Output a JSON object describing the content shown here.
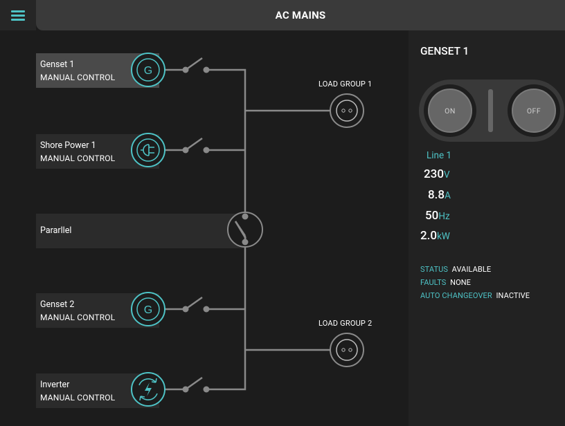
{
  "header": {
    "title": "AC MAINS"
  },
  "sources": [
    {
      "name": "Genset 1",
      "mode": "MANUAL CONTROL",
      "icon": "generator-icon"
    },
    {
      "name": "Shore Power 1",
      "mode": "MANUAL CONTROL",
      "icon": "shore-power-icon"
    },
    {
      "name": "Genset 2",
      "mode": "MANUAL CONTROL",
      "icon": "generator-icon"
    },
    {
      "name": "Inverter",
      "mode": "MANUAL CONTROL",
      "icon": "inverter-icon"
    }
  ],
  "parallel": {
    "label": "Pararllel"
  },
  "loads": [
    {
      "label": "LOAD GROUP 1"
    },
    {
      "label": "LOAD GROUP 2"
    }
  ],
  "panel": {
    "title": "GENSET 1",
    "on_label": "ON",
    "off_label": "OFF",
    "line_label": "Line 1",
    "voltage": {
      "value": "230",
      "unit": "V"
    },
    "current": {
      "value": "8.8",
      "unit": "A"
    },
    "frequency": {
      "value": "50",
      "unit": "Hz"
    },
    "power": {
      "value": "2.0",
      "unit": "kW"
    },
    "status": {
      "key": "STATUS",
      "value": "AVAILABLE"
    },
    "faults": {
      "key": "FAULTS",
      "value": "NONE"
    },
    "auto_changeover": {
      "key": "AUTO CHANGEOVER",
      "value": "INACTIVE"
    }
  },
  "colors": {
    "accent": "#4ec3c6",
    "line": "#8a8a8a",
    "header": "#3a3a3a",
    "background": "#1c1c1c"
  },
  "generator_glyph": "G"
}
